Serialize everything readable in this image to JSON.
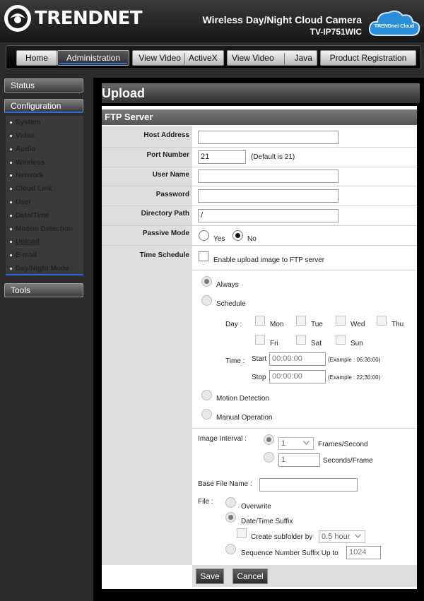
{
  "header": {
    "brand": "TRENDNET",
    "product_title": "Wireless Day/Night Cloud Camera",
    "model": "TV-IP751WIC",
    "cloud_badge": "TRENDnet Cloud"
  },
  "topnav": {
    "home": "Home",
    "administration": "Administration",
    "view_video_activex_a": "View Video",
    "view_video_activex_b": "ActiveX",
    "view_video_java_a": "View Video",
    "view_video_java_b": "Java",
    "product_registration": "Product Registration"
  },
  "sidebar": {
    "status": "Status",
    "configuration": "Configuration",
    "tools": "Tools",
    "items": [
      "System",
      "Video",
      "Audio",
      "Wireless",
      "Network",
      "Cloud Link",
      "User",
      "Date/Time",
      "Motion Detection",
      "Upload",
      "E-mail",
      "Day/Night Mode"
    ],
    "current": "Upload"
  },
  "page": {
    "title": "Upload",
    "section": "FTP Server"
  },
  "form": {
    "host_address_label": "Host Address",
    "host_address_value": "",
    "port_number_label": "Port Number",
    "port_number_value": "21",
    "port_default_note": "(Default is 21)",
    "user_name_label": "User Name",
    "user_name_value": "",
    "password_label": "Password",
    "password_value": "",
    "directory_path_label": "Directory Path",
    "directory_path_value": "/",
    "passive_mode_label": "Passive Mode",
    "passive_yes": "Yes",
    "passive_no": "No",
    "passive_selected": "No",
    "time_schedule_label": "Time Schedule",
    "enable_upload": "Enable upload image to FTP server",
    "always": "Always",
    "schedule": "Schedule",
    "day_label": "Day :",
    "days": [
      "Mon",
      "Tue",
      "Wed",
      "Thu",
      "Fri",
      "Sat",
      "Sun"
    ],
    "time_label": "Time :",
    "start_label": "Start",
    "start_value": "00:00:00",
    "start_example": "(Example : 06:30:00)",
    "stop_label": "Stop",
    "stop_value": "00:00:00",
    "stop_example": "(Example : 22:30:00)",
    "motion_detection": "Motion Detection",
    "manual_operation": "Manual Operation",
    "image_interval_label": "Image Interval :",
    "frames_value": "1",
    "frames_unit": "Frames/Second",
    "seconds_value": "1",
    "seconds_unit": "Seconds/Frame",
    "base_file_name_label": "Base File Name :",
    "base_file_name_value": "",
    "file_label": "File :",
    "overwrite": "Overwrite",
    "datetime_suffix": "Date/Time Suffix",
    "create_subfolder": "Create subfolder by",
    "subfolder_value": "0.5 hour",
    "sequence_suffix": "Sequence Number Suffix Up to",
    "sequence_value": "1024"
  },
  "actions": {
    "save": "Save",
    "cancel": "Cancel"
  }
}
